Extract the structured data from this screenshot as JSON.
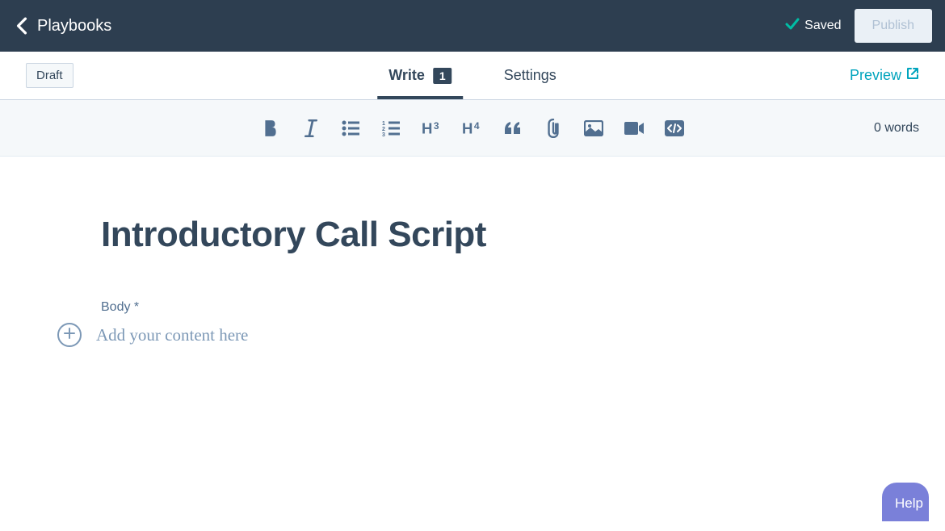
{
  "header": {
    "back_label": "Playbooks",
    "saved_label": "Saved",
    "publish_label": "Publish"
  },
  "subheader": {
    "draft_badge": "Draft",
    "tabs": [
      {
        "label": "Write",
        "badge": "1",
        "active": true
      },
      {
        "label": "Settings",
        "active": false
      }
    ],
    "preview_label": "Preview"
  },
  "toolbar": {
    "word_count": "0 words",
    "tools": [
      "bold",
      "italic",
      "bullet-list",
      "ordered-list",
      "heading-3",
      "heading-4",
      "quote",
      "attachment",
      "image",
      "video",
      "embed"
    ]
  },
  "editor": {
    "title": "Introductory Call Script",
    "body_label": "Body *",
    "body_placeholder": "Add your content here"
  },
  "help": {
    "label": "Help"
  }
}
